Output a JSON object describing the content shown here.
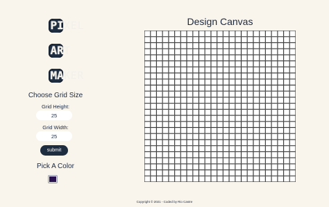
{
  "title": {
    "line1": "PIXEL",
    "line2": "ART",
    "line3": "MAKER"
  },
  "grid_size": {
    "heading": "Choose Grid Size",
    "height_label": "Grid Height:",
    "height_value": "25",
    "width_label": "Grid Width:",
    "width_value": "25",
    "submit_label": "submit"
  },
  "color": {
    "heading": "Pick A Color",
    "selected": "#2a1150"
  },
  "canvas": {
    "title": "Design Canvas",
    "rows": 25,
    "cols": 25
  },
  "footer": {
    "text": "Copyright © 2021 - Coded by Rio Castre"
  }
}
